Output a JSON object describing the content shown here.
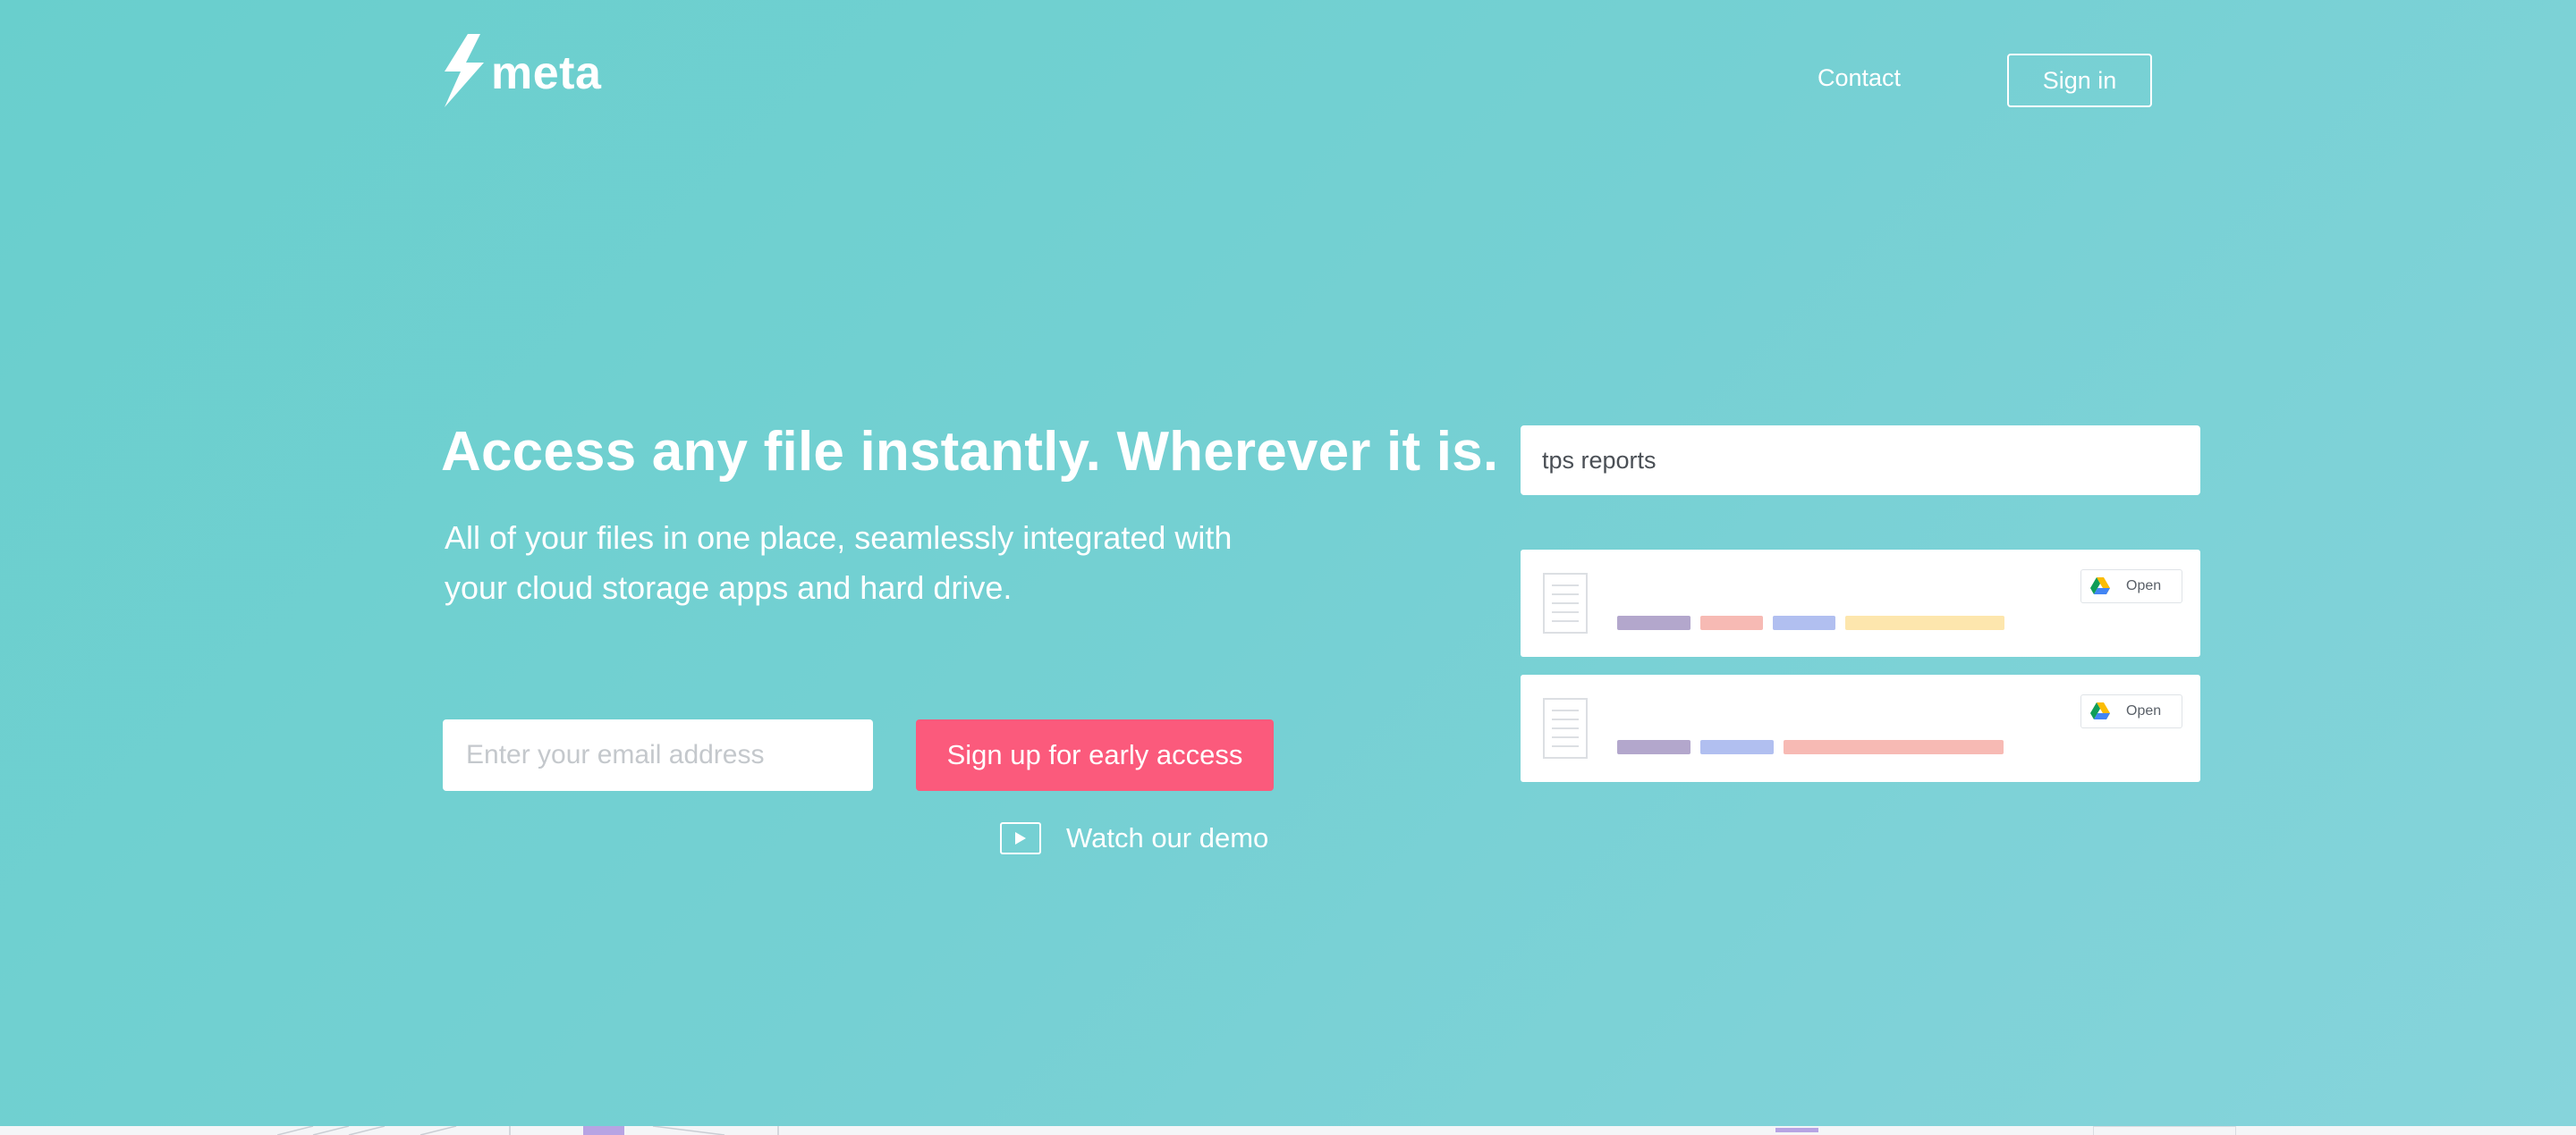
{
  "brand": {
    "name": "meta",
    "logo_icon": "lightning-bolt-icon"
  },
  "nav": {
    "contact_label": "Contact",
    "signin_label": "Sign in"
  },
  "hero": {
    "headline": "Access any file instantly. Wherever it is.",
    "subhead_line1": "All of your files in one place, seamlessly integrated with",
    "subhead_line2": "your cloud storage apps and hard drive."
  },
  "signup": {
    "email_placeholder": "Enter your email address",
    "button_label": "Sign up for early access",
    "demo_label": "Watch our demo"
  },
  "preview": {
    "search_query": "tps reports",
    "results": [
      {
        "open_label": "Open",
        "source_icon": "google-drive-icon",
        "tag_colors": [
          "#b3a7cc",
          "#f7bab4",
          "#b1bff0",
          "#fde6ad"
        ]
      },
      {
        "open_label": "Open",
        "source_icon": "google-drive-icon",
        "tag_colors": [
          "#b3a7cc",
          "#b1bff0",
          "#f7bab4"
        ]
      }
    ]
  },
  "colors": {
    "background_start": "#69cfcd",
    "background_end": "#86d4db",
    "accent_button": "#fb5a7c",
    "text": "#ffffff"
  }
}
